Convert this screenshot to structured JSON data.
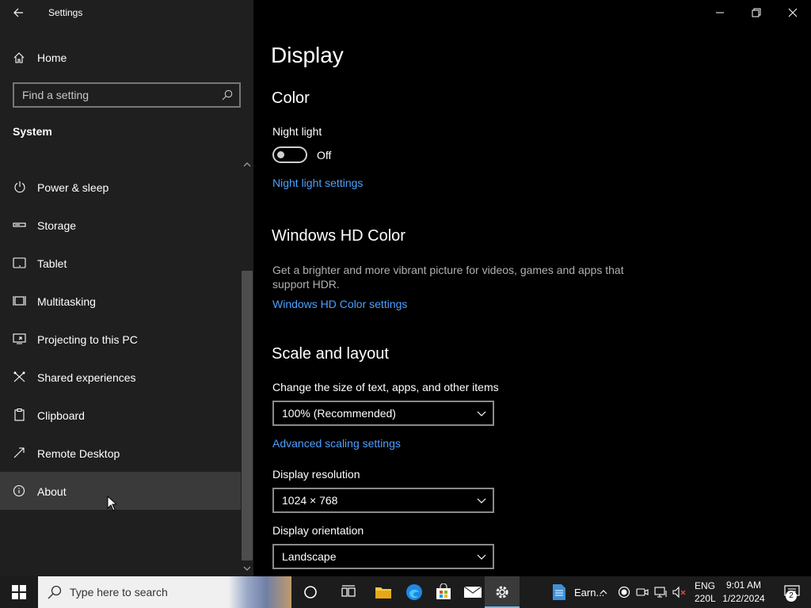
{
  "window": {
    "title": "Settings",
    "home_label": "Home",
    "search_placeholder": "Find a setting",
    "section_title": "System"
  },
  "sidebar": {
    "items": [
      {
        "label": "Power & sleep",
        "icon": "power-icon"
      },
      {
        "label": "Storage",
        "icon": "storage-icon"
      },
      {
        "label": "Tablet",
        "icon": "tablet-icon"
      },
      {
        "label": "Multitasking",
        "icon": "multitasking-icon"
      },
      {
        "label": "Projecting to this PC",
        "icon": "projecting-icon"
      },
      {
        "label": "Shared experiences",
        "icon": "shared-experiences-icon"
      },
      {
        "label": "Clipboard",
        "icon": "clipboard-icon"
      },
      {
        "label": "Remote Desktop",
        "icon": "remote-desktop-icon"
      },
      {
        "label": "About",
        "icon": "info-icon",
        "hovered": true
      }
    ]
  },
  "main": {
    "page_title": "Display",
    "color": {
      "heading": "Color",
      "night_light_label": "Night light",
      "night_light_state": "Off",
      "night_light_link": "Night light settings"
    },
    "hdr": {
      "heading": "Windows HD Color",
      "description": "Get a brighter and more vibrant picture for videos, games and apps that support HDR.",
      "link": "Windows HD Color settings"
    },
    "scale": {
      "heading": "Scale and layout",
      "size_label": "Change the size of text, apps, and other items",
      "size_value": "100% (Recommended)",
      "advanced_link": "Advanced scaling settings",
      "resolution_label": "Display resolution",
      "resolution_value": "1024 × 768",
      "orientation_label": "Display orientation",
      "orientation_value": "Landscape"
    }
  },
  "taskbar": {
    "search_text": "Type here to search",
    "pinned_app_label": "Earn...",
    "language": "ENG",
    "language_sub": "220L",
    "time": "9:01 AM",
    "date": "1/22/2024",
    "notification_count": "2"
  },
  "colors": {
    "accent_link": "#4ca0ff",
    "sidebar_bg": "#1f1f1f",
    "content_bg": "#000000"
  }
}
